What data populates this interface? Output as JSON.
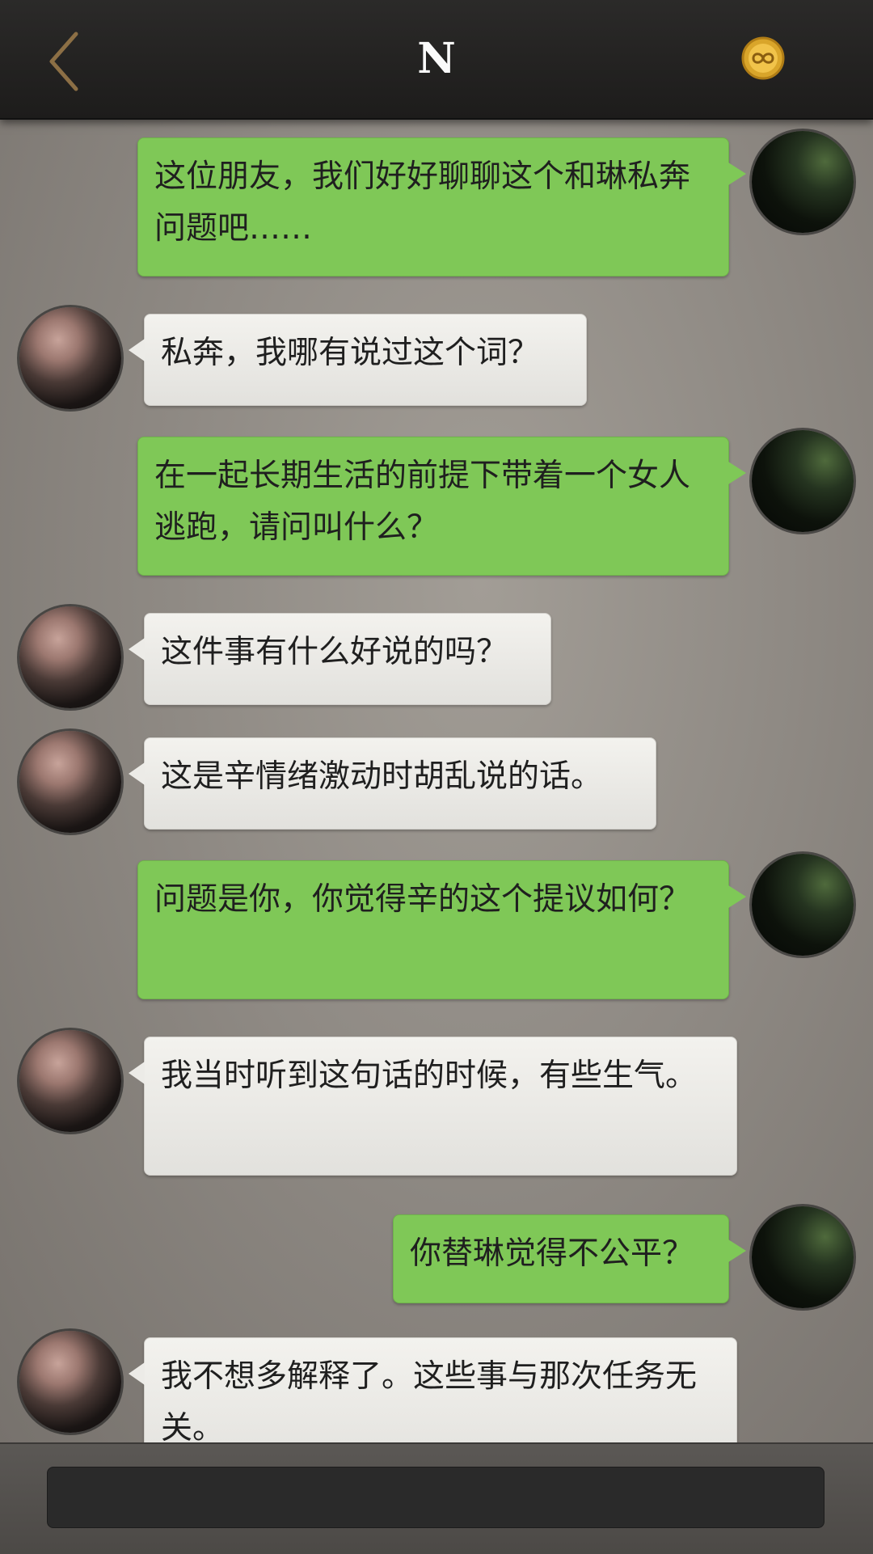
{
  "header": {
    "back_icon": "chevron-left-icon",
    "title": "N",
    "badge_icon": "infinity-coin-icon"
  },
  "messages": [
    {
      "side": "out",
      "text": "这位朋友，我们好好聊聊这个和琳私奔问题吧……"
    },
    {
      "side": "in",
      "text": "私奔，我哪有说过这个词？"
    },
    {
      "side": "out",
      "text": "在一起长期生活的前提下带着一个女人逃跑，请问叫什么？"
    },
    {
      "side": "in",
      "text": "这件事有什么好说的吗？"
    },
    {
      "side": "in",
      "text": "这是辛情绪激动时胡乱说的话。"
    },
    {
      "side": "out",
      "text": "问题是你，你觉得辛的这个提议如何？"
    },
    {
      "side": "in",
      "text": "我当时听到这句话的时候，有些生气。"
    },
    {
      "side": "out",
      "text": "你替琳觉得不公平？"
    },
    {
      "side": "in",
      "text": "我不想多解释了。这些事与那次任务无关。"
    }
  ],
  "composer": {
    "placeholder": ""
  },
  "colors": {
    "outgoing_bubble": "#7fc857",
    "incoming_bubble": "#ecebe7",
    "topbar": "#242322"
  }
}
